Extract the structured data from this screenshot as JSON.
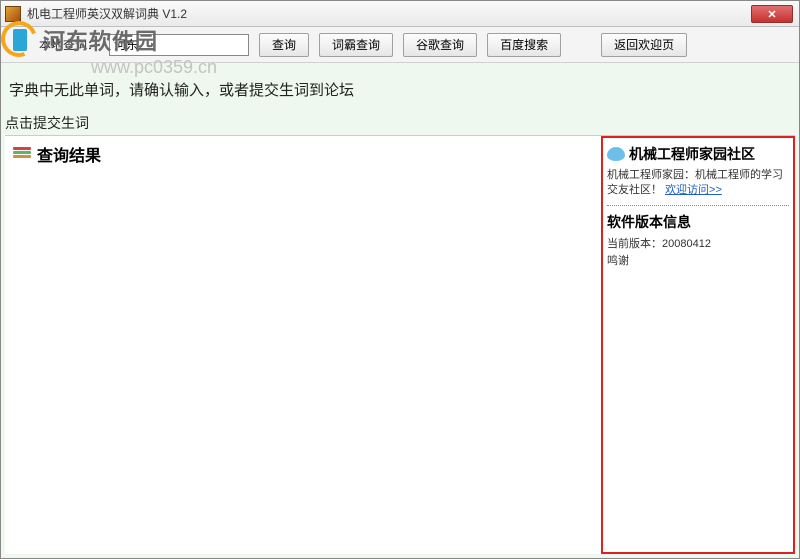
{
  "window": {
    "title": "机电工程师英汉双解词典 V1.2"
  },
  "watermark": {
    "text": "河东软件园",
    "url": "www.pc0359.cn"
  },
  "toolbar": {
    "label": "本地查词：",
    "search_value": "河东",
    "buttons": {
      "query": "查询",
      "powerword": "词霸查询",
      "google": "谷歌查询",
      "baidu": "百度搜索",
      "back": "返回欢迎页"
    }
  },
  "messages": {
    "not_found": "字典中无此单词，请确认输入，或者提交生词到论坛",
    "submit_word": "点击提交生词"
  },
  "result": {
    "title": "查询结果"
  },
  "side": {
    "title": "机械工程师家园社区",
    "desc_prefix": "机械工程师家园：机械工程师的学习交友社区！",
    "link": "欢迎访问>>",
    "version_title": "软件版本信息",
    "version_line": "当前版本：20080412",
    "thanks": "鸣谢"
  }
}
